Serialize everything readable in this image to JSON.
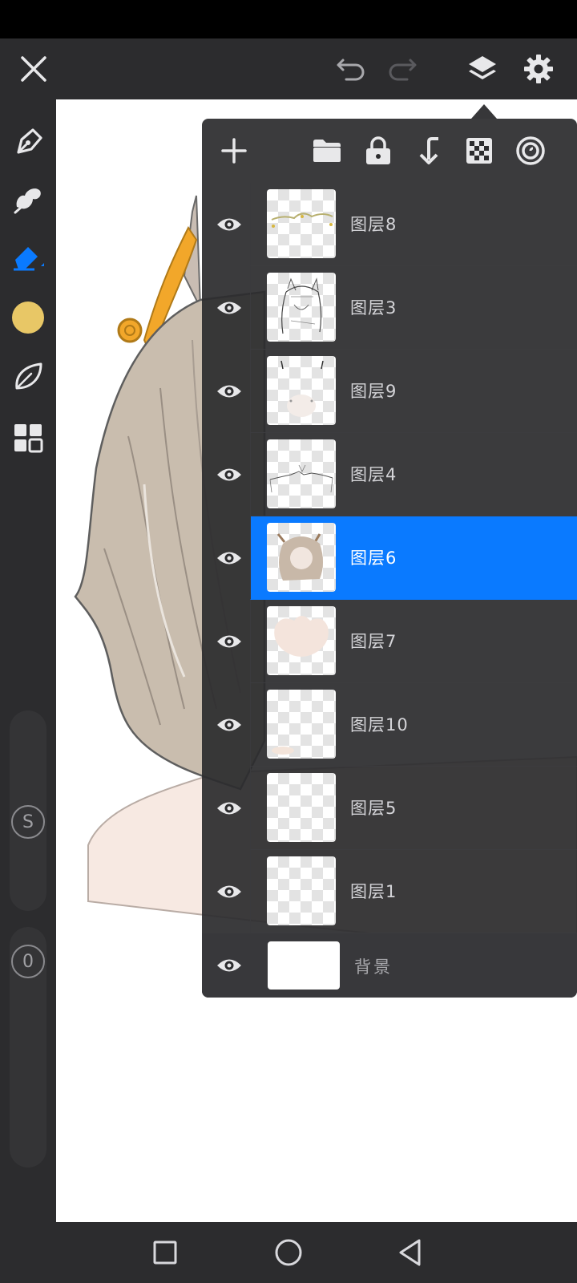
{
  "colors": {
    "accent": "#0a7aff",
    "panel_bg": "#2c2c2e",
    "brush_color": "#e8c766",
    "icon": "#e8e8ea"
  },
  "top_toolbar": {
    "icons": [
      "close-icon",
      "undo-icon",
      "redo-icon",
      "layers-icon",
      "gear-icon"
    ]
  },
  "left_toolbar": {
    "icons": [
      "pen-tool-icon",
      "smudge-tool-icon",
      "eraser-tool-icon",
      "color-swatch",
      "leaf-icon",
      "grid-icon"
    ],
    "size_slider_label": "S",
    "opacity_slider_label": "0"
  },
  "layers_panel": {
    "toolbar_icons": [
      "add-layer-icon",
      "folder-icon",
      "lock-icon",
      "merge-down-icon",
      "checker-icon",
      "blend-mode-icon"
    ],
    "layers": [
      {
        "name": "图层8",
        "visible": true,
        "selected": false
      },
      {
        "name": "图层3",
        "visible": true,
        "selected": false
      },
      {
        "name": "图层9",
        "visible": true,
        "selected": false
      },
      {
        "name": "图层4",
        "visible": true,
        "selected": false
      },
      {
        "name": "图层6",
        "visible": true,
        "selected": true
      },
      {
        "name": "图层7",
        "visible": true,
        "selected": false
      },
      {
        "name": "图层10",
        "visible": true,
        "selected": false
      },
      {
        "name": "图层5",
        "visible": true,
        "selected": false
      },
      {
        "name": "图层1",
        "visible": true,
        "selected": false
      }
    ],
    "background_layer": {
      "name": "背景",
      "visible": true
    }
  },
  "nav_bar": {
    "icons": [
      "recents-icon",
      "home-icon",
      "back-icon"
    ]
  }
}
